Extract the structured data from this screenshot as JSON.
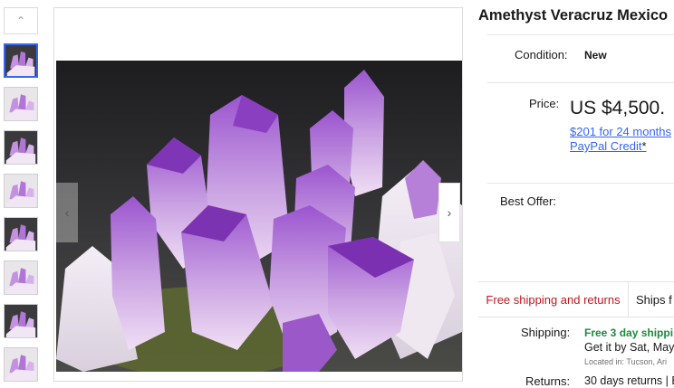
{
  "listing": {
    "title": "Amethyst Veracruz Mexico",
    "condition_label": "Condition:",
    "condition_value": "New",
    "price_label": "Price:",
    "price_value": "US $4,500.",
    "paypal_line1": "$201 for 24 months",
    "paypal_line2": "PayPal Credit",
    "paypal_star": "*",
    "best_offer_label": "Best Offer:",
    "free_shipping_tab": "Free shipping and returns",
    "ships_tab": "Ships f",
    "shipping_label": "Shipping:",
    "shipping_speed": "Free 3 day shippi",
    "shipping_getit": "Get it by Sat, May",
    "shipping_location": "Located in: Tucson, Ari",
    "returns_label": "Returns:",
    "returns_value": "30 days returns | B"
  },
  "gallery": {
    "thumbnail_count": 8,
    "active_index": 0,
    "up_icon": "chevron-up-icon",
    "prev_icon": "chevron-left-icon",
    "next_icon": "chevron-right-icon"
  },
  "colors": {
    "accent_blue": "#3665f3",
    "free_red": "#c4151c",
    "ship_green": "#1e8a3d",
    "crystal_purple": "#a46ad2"
  }
}
